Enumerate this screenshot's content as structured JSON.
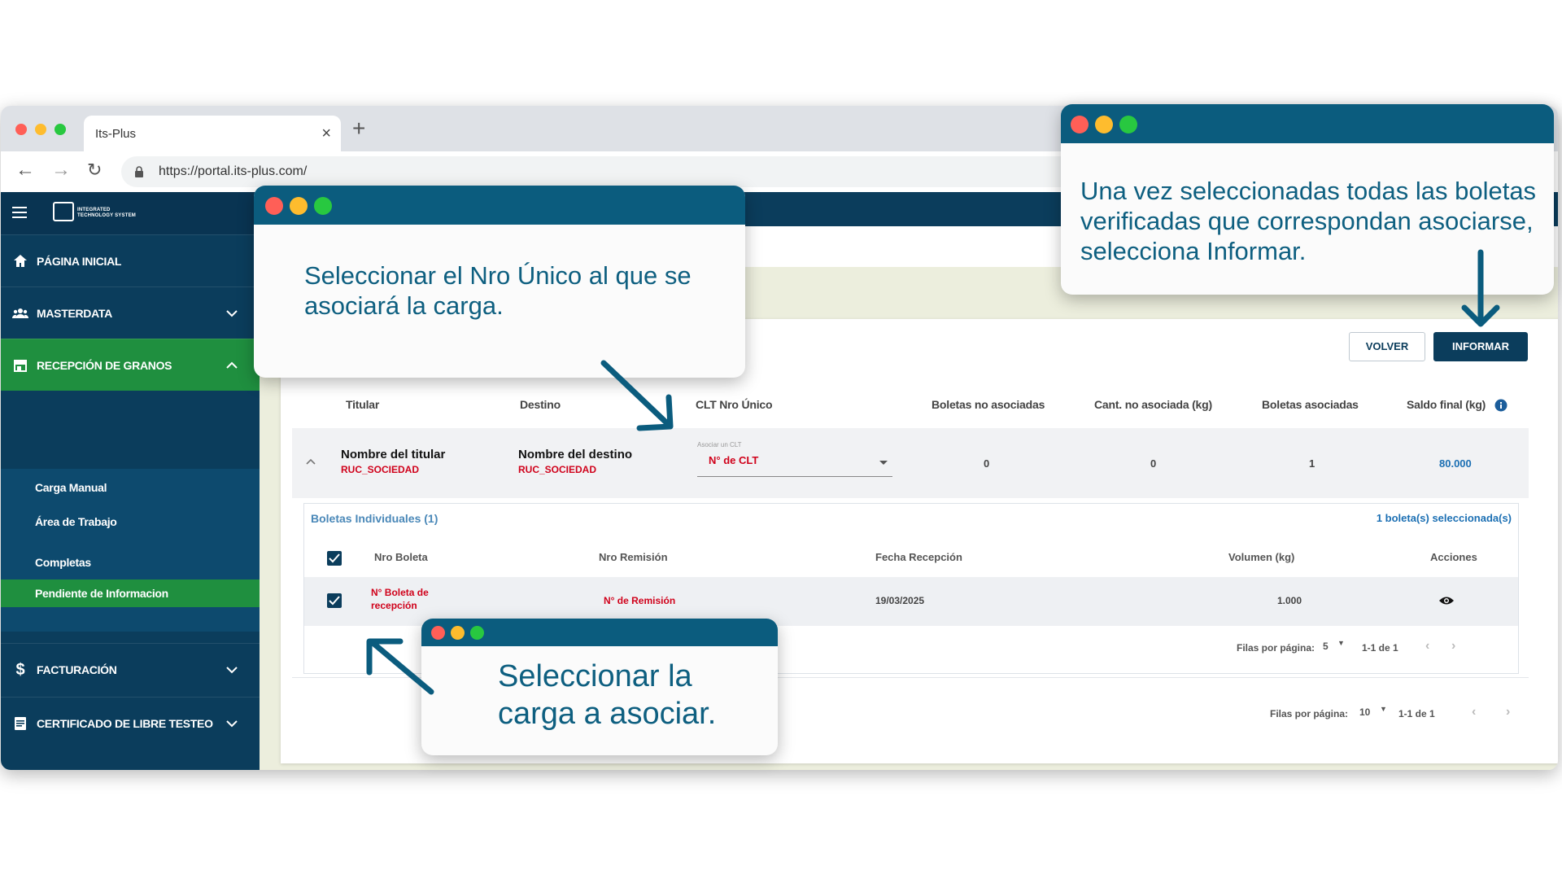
{
  "browser": {
    "tab_title": "Its-Plus",
    "tab_close": "×",
    "new_tab": "+",
    "url": "https://portal.its-plus.com/"
  },
  "sidebar": {
    "logo_line1": "INTEGRATED",
    "logo_line2": "TECHNOLOGY SYSTEM",
    "items": [
      {
        "label": "PÁGINA INICIAL"
      },
      {
        "label": "MASTERDATA"
      },
      {
        "label": "RECEPCIÓN DE GRANOS"
      },
      {
        "label": "FACTURACIÓN"
      },
      {
        "label": "CERTIFICADO DE LIBRE TESTEO"
      }
    ],
    "subitems": [
      {
        "label": "Carga Manual"
      },
      {
        "label": "Área de Trabajo"
      },
      {
        "label": "Completas"
      },
      {
        "label": "Pendiente de Informacion"
      }
    ]
  },
  "actions": {
    "volver": "VOLVER",
    "informar": "INFORMAR"
  },
  "table": {
    "headers": [
      "Titular",
      "Destino",
      "CLT Nro Único",
      "Boletas no asociadas",
      "Cant. no asociada (kg)",
      "Boletas asociadas",
      "Saldo final (kg)"
    ],
    "row": {
      "titular": "Nombre del titular",
      "titular_ruc": "RUC_SOCIEDAD",
      "destino": "Nombre del destino",
      "destino_ruc": "RUC_SOCIEDAD",
      "clt_label": "Asociar un CLT",
      "clt_value": "N° de CLT",
      "boletas_no_asociadas": "0",
      "cant_no_asociada": "0",
      "boletas_asociadas": "1",
      "saldo_final": "80.000"
    }
  },
  "subtable": {
    "title": "Boletas Individuales (1)",
    "selected": "1 boleta(s) seleccionada(s)",
    "headers": [
      "Nro Boleta",
      "Nro Remisión",
      "Fecha Recepción",
      "Volumen (kg)",
      "Acciones"
    ],
    "row": {
      "nro_boleta_1": "N° Boleta de",
      "nro_boleta_2": "recepción",
      "nro_remision": "N° de Remisión",
      "fecha": "19/03/2025",
      "volumen": "1.000"
    },
    "pager": {
      "label": "Filas por página:",
      "rows": "5",
      "range": "1-1 de 1"
    }
  },
  "outer_pager": {
    "label": "Filas por página:",
    "rows": "10",
    "range": "1-1 de 1"
  },
  "callouts": {
    "clt": {
      "line1": "Seleccionar el Nro Único al que se",
      "line2": "asociará la carga."
    },
    "informar": {
      "line1": "Una vez seleccionadas todas las boletas",
      "line2": "verificadas que correspondan asociarse,",
      "line3": "selecciona Informar."
    },
    "carga": {
      "line1": "Seleccionar la",
      "line2": "carga a asociar."
    }
  },
  "colors": {
    "brand_dark": "#0b3d5c",
    "active_green": "#1f8f3f",
    "callout_bar": "#0b5c7e",
    "highlight_red": "#d0021b"
  }
}
